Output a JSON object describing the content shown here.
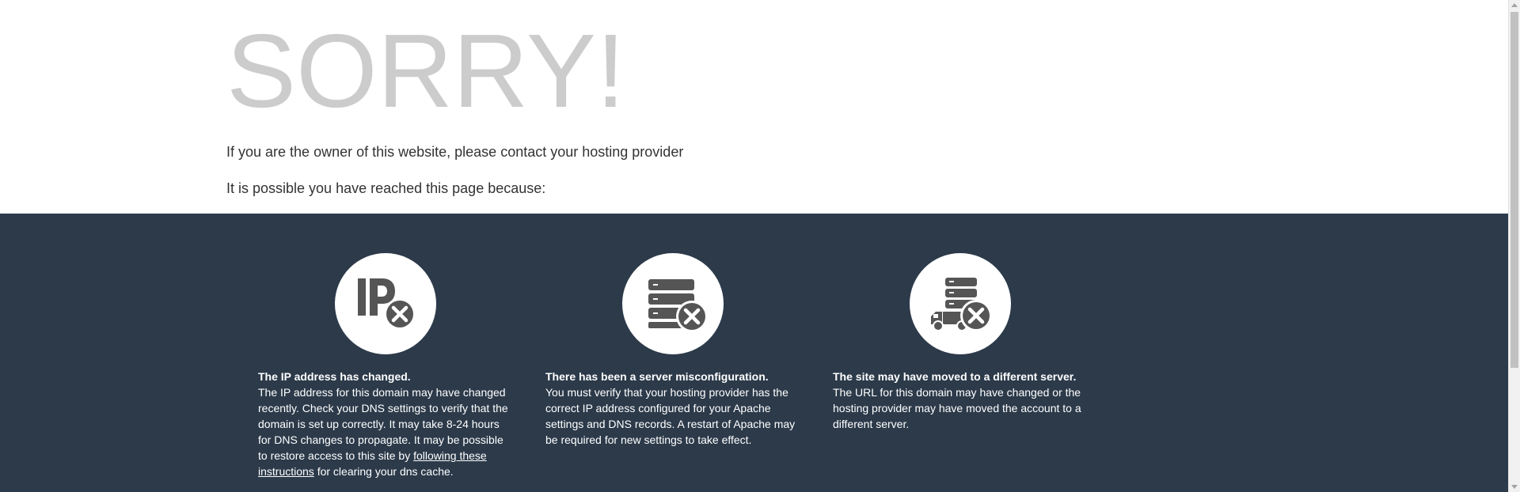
{
  "header": {
    "title": "SORRY!",
    "owner_text": "If you are the owner of this website, please contact your hosting provider",
    "possible_text": "It is possible you have reached this page because:"
  },
  "reasons": [
    {
      "icon": "ip-error-icon",
      "title": "The IP address has changed.",
      "body": "The IP address for this domain may have changed recently. Check your DNS settings to verify that the domain is set up correctly. It may take 8-24 hours for DNS changes to propagate. It may be possible to restore access to this site by ",
      "link": "following these instructions",
      "after_link": " for clearing your dns cache."
    },
    {
      "icon": "server-error-icon",
      "title": "There has been a server misconfiguration.",
      "body": "You must verify that your hosting provider has the correct IP address configured for your Apache settings and DNS records. A restart of Apache may be required for new settings to take effect."
    },
    {
      "icon": "server-moved-icon",
      "title": "The site may have moved to a different server.",
      "body": "The URL for this domain may have changed or the hosting provider may have moved the account to a different server."
    }
  ],
  "colors": {
    "top_background": "#ffffff",
    "bottom_background": "#2c3a4a",
    "title_color": "#cccccc",
    "text_color": "#333333",
    "icon_color": "#555555"
  }
}
